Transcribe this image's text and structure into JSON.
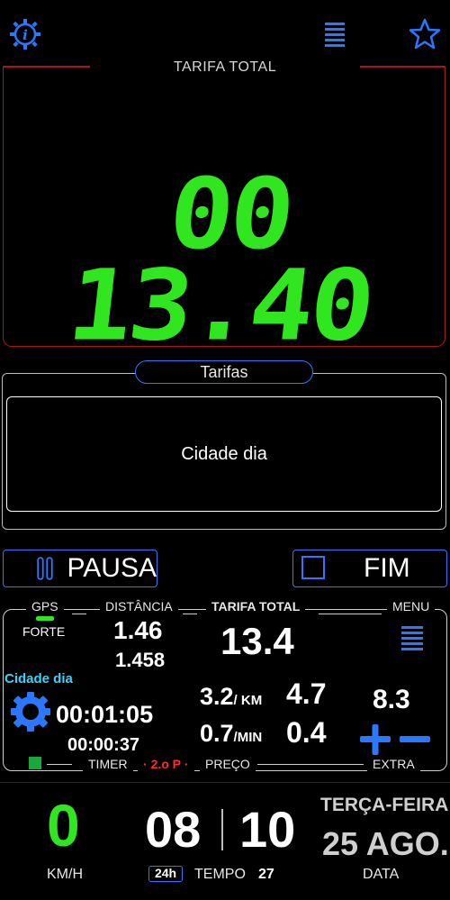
{
  "fare": {
    "label": "TARIFA TOTAL",
    "value": "00 13.40"
  },
  "tariffs": {
    "title": "Tarifas",
    "selected": "Cidade dia"
  },
  "buttons": {
    "pause": "PAUSA",
    "end": "FIM"
  },
  "info": {
    "gps_label": "GPS",
    "gps_status": "FORTE",
    "distance_label": "DISTÂNCIA",
    "distance_main": "1.46",
    "distance_sub": "1.458",
    "total_label": "TARIFA TOTAL",
    "total_value": "13.4",
    "menu_label": "MENU",
    "tariff_name": "Cidade dia",
    "timer_main": "00:01:05",
    "timer_sub": "00:00:37",
    "rate_km": "3.2",
    "rate_km_unit": "/ KM",
    "km_value": "4.7",
    "rate_min": "0.7",
    "rate_min_unit": "/MIN",
    "min_value": "0.4",
    "extra_value": "8.3",
    "timer_label": "TIMER",
    "period_label": "2.o P",
    "price_label": "PREÇO",
    "extra_label": "EXTRA"
  },
  "bottom": {
    "speed": "0",
    "speed_unit": "KM/H",
    "hour": "08",
    "minute": "10",
    "time_format": "24h",
    "time_label": "TEMPO",
    "time_extra": "27",
    "weekday": "TERÇA-FEIRA",
    "date": "25 AGO.",
    "date_label": "DATA"
  },
  "colors": {
    "accent": "#2b78ff",
    "digits": "#2fe61f",
    "frame": "#b0121b",
    "cyan": "#34d6ff",
    "period": "#ff2a2a"
  }
}
